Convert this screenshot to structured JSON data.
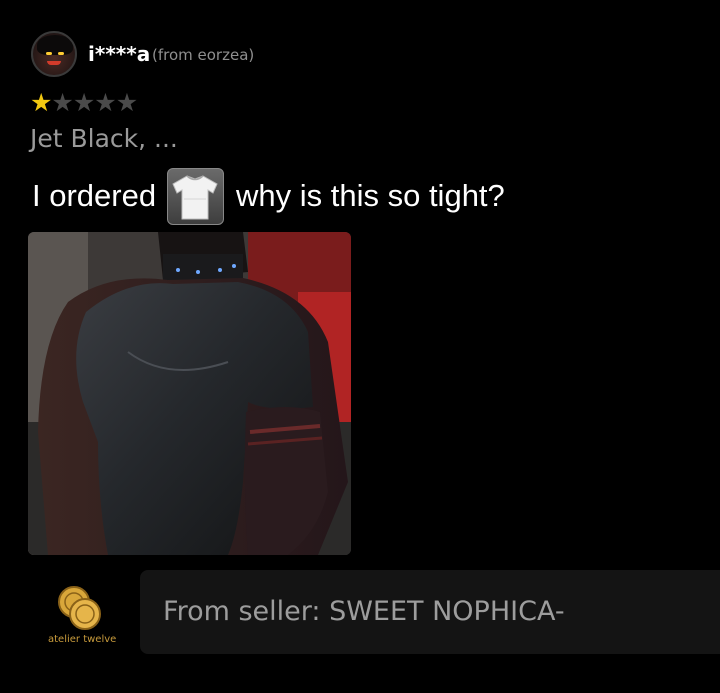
{
  "review": {
    "username": "i****a",
    "origin": "(from eorzea)",
    "rating": 1,
    "rating_max": 5,
    "variant": "Jet Black, ...",
    "comment_before": "I ordered",
    "comment_after": "why is this so tight?",
    "item_icon": "white-tshirt-icon"
  },
  "seller": {
    "name": "atelier twelve",
    "reply": "From seller: SWEET NOPHICA-",
    "logo_icon": "gold-coins-icon"
  },
  "colors": {
    "background": "#000000",
    "star_filled": "#f2c811",
    "star_empty": "#4a4a4a",
    "muted_text": "#9a9a9a",
    "seller_name": "#c89b3c",
    "reply_box": "#141414"
  }
}
